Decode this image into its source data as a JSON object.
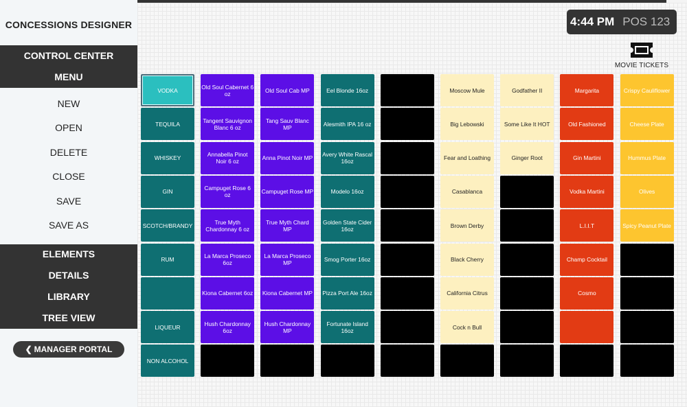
{
  "app": {
    "title": "CONCESSIONS DESIGNER"
  },
  "menu_top": [
    "CONTROL CENTER",
    "MENU"
  ],
  "file_menu": [
    "NEW",
    "OPEN",
    "DELETE",
    "CLOSE",
    "SAVE",
    "SAVE AS"
  ],
  "menu_bottom": [
    "ELEMENTS",
    "DETAILS",
    "LIBRARY",
    "TREE VIEW"
  ],
  "manager_portal": {
    "label": "MANAGER PORTAL",
    "icon": "chevron-left-icon"
  },
  "clock": {
    "time": "4:44 PM",
    "pos": "POS 123"
  },
  "movie_tickets": {
    "label": "MOVIE TICKETS",
    "icon": "ticket-icon"
  },
  "colors": {
    "teal": "#0f6f72",
    "teal_selected": "#2bbfbf",
    "purple": "#5c0fe6",
    "black": "#000000",
    "cream": "#fdf0c0",
    "red": "#e23b14",
    "yellow": "#fdc52f"
  },
  "grid": {
    "columns": [
      {
        "color": "teal",
        "cells": [
          "VODKA",
          "TEQUILA",
          "WHISKEY",
          "GIN",
          "SCOTCH/BRANDY",
          "RUM",
          "",
          "LIQUEUR",
          "NON ALCOHOL"
        ]
      },
      {
        "color": "purple",
        "cells": [
          "Old Soul Cabernet 6 oz",
          "Tangent Sauvignon Blanc 6 oz",
          "Annabella Pinot Noir 6 oz",
          "Campuget Rose 6 oz",
          "True Myth Chardonnay 6 oz",
          "La Marca Proseco 6oz",
          "Kiona Cabernet 6oz",
          "Hush Chardonnay 6oz",
          null
        ]
      },
      {
        "color": "purple",
        "cells": [
          "Old Soul Cab MP",
          "Tang Sauv Blanc MP",
          "Anna Pinot Noir MP",
          "Campuget Rose MP",
          "True Myth Chard MP",
          "La Marca Proseco MP",
          "Kiona Cabernet MP",
          "Hush Chardonnay MP",
          null
        ]
      },
      {
        "color": "teal",
        "cells": [
          "Eel Blonde 16oz",
          "Alesmith IPA 16 oz",
          "Avery White Rascal 16oz",
          "Modelo 16oz",
          "Golden State Cider 16oz",
          "Smog Porter 16oz",
          "Pizza Port Ale 16oz",
          "Fortunate Island 16oz",
          null
        ]
      },
      {
        "color": "black",
        "cells": [
          null,
          null,
          null,
          null,
          null,
          null,
          null,
          null,
          null
        ]
      },
      {
        "color": "cream",
        "cells": [
          "Moscow Mule",
          "Big Lebowski",
          "Fear and Loathing",
          "Casablanca",
          "Brown Derby",
          "Black Cherry",
          "California Citrus",
          "Cock n Bull",
          null
        ]
      },
      {
        "color": "cream",
        "cells": [
          "Godfather II",
          "Some Like It HOT",
          "Ginger Root",
          null,
          null,
          null,
          null,
          null,
          null
        ]
      },
      {
        "color": "red",
        "cells": [
          "Margarita",
          "Old Fashioned",
          "Gin Martini",
          "Vodka Martini",
          "L.I.I.T",
          "Champ Cocktail",
          "Cosmo",
          "",
          null
        ]
      },
      {
        "color": "yellow",
        "cells": [
          "Crispy Cauliflower",
          "Cheese Plate",
          "Hummus Plate",
          "Olives",
          "Spicy Peanut Plate",
          null,
          null,
          null,
          null
        ]
      }
    ]
  }
}
